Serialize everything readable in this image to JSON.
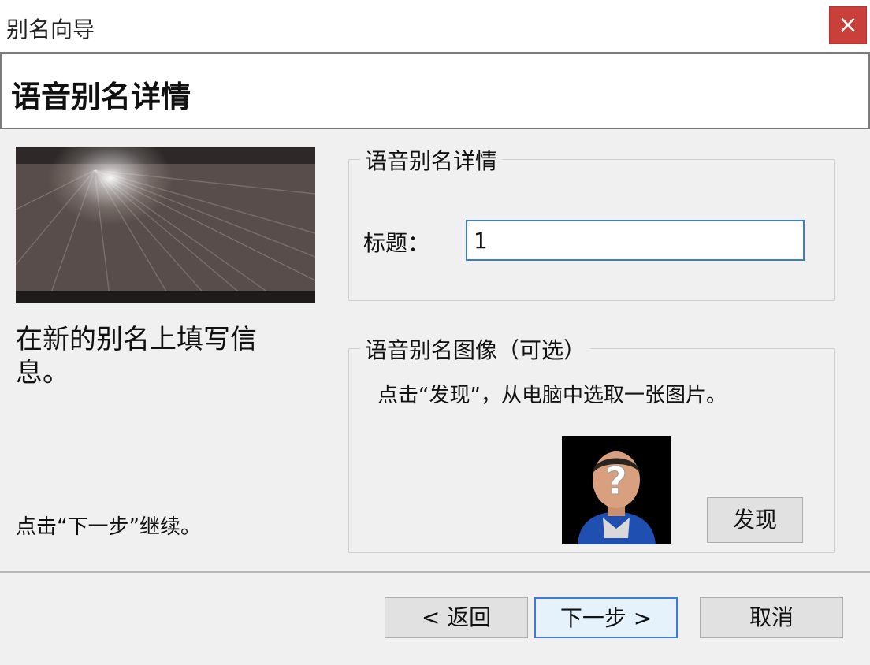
{
  "window": {
    "title": "别名向导",
    "close_glyph": "×"
  },
  "header": {
    "heading": "语音别名详情"
  },
  "left": {
    "instruction": "在新的别名上填写信息。",
    "continue_hint": "点击“下一步”继续。"
  },
  "details_group": {
    "legend": "语音别名详情",
    "title_label": "标题：",
    "title_value": "1"
  },
  "image_group": {
    "legend": "语音别名图像（可选）",
    "hint": "点击“发现”，从电脑中选取一张图片。",
    "find_button": "发现",
    "placeholder_icon": "unknown-person-icon"
  },
  "buttons": {
    "back": "< 返回",
    "next": "下一步 >",
    "cancel": "取消"
  },
  "colors": {
    "close": "#c9403a",
    "focus_border": "#3d7bd6",
    "dialog_bg": "#f0f0f0"
  }
}
